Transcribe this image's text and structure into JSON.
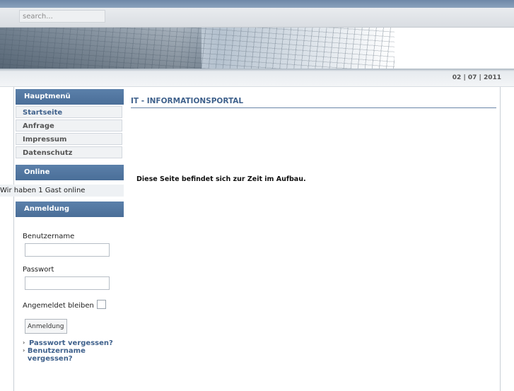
{
  "search": {
    "placeholder": "search..."
  },
  "header": {
    "date": "02 | 07 | 2011"
  },
  "sidebar": {
    "main_menu_title": "Hauptmenü",
    "menu_items": [
      {
        "label": "Startseite",
        "active": true
      },
      {
        "label": "Anfrage",
        "active": false
      },
      {
        "label": "Impressum",
        "active": false
      },
      {
        "label": "Datenschutz",
        "active": false
      }
    ],
    "online_title": "Online",
    "online_text": "Wir haben 1 Gast online",
    "login_title": "Anmeldung",
    "username_label": "Benutzername",
    "password_label": "Passwort",
    "remember_label": "Angemeldet bleiben",
    "login_button": "Anmeldung",
    "forgot_password": "Passwort vergessen?",
    "forgot_username": "Benutzername vergessen?"
  },
  "main": {
    "title": "IT - INFORMATIONSPORTAL",
    "notice": "Diese Seite befindet sich zur Zeit im Aufbau."
  },
  "colors": {
    "accent": "#4a6e98",
    "link": "#3f618c",
    "topstrip": "#7b93b0"
  }
}
